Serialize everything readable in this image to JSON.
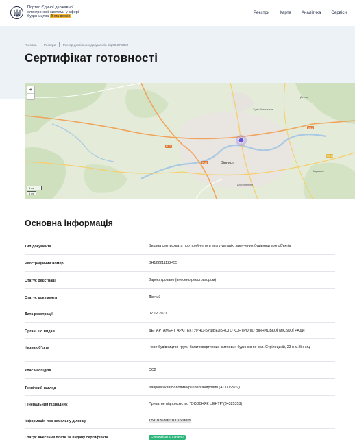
{
  "header": {
    "brand_line1": "Портал Єдиної державної",
    "brand_line2": "електронної системи у сфері",
    "brand_line3": "будівництва",
    "badge": "Бета-версія",
    "nav": [
      "Реєстри",
      "Карта",
      "Аналітика",
      "Сервіси"
    ]
  },
  "breadcrumb": [
    "Головна",
    "Реєстри",
    "Реєстр дозвільних документів від 05.07.2020"
  ],
  "page_title": "Сертифікат готовності",
  "map": {
    "zoom_in": "+",
    "zoom_out": "−",
    "scale_km": "3 км",
    "scale_mi": "1 mi",
    "labels": {
      "city": "Вінниця",
      "district_n": "Хутір Шевченка",
      "village_ne": "Десна",
      "label_agro": "Агрономічне",
      "label_east": "Зарванці",
      "road_a": "М-12",
      "road_b": "М-12",
      "road_c": "Р-33",
      "road_d": "Т-02-12"
    }
  },
  "section_title": "Основна інформація",
  "rows": [
    {
      "key": "Тип документа",
      "value": "Видача сертифіката про прийняття в експлуатацію закінчених будівництвом об'єктів"
    },
    {
      "key": "Реєстраційний номер",
      "value": "ВН122211122455"
    },
    {
      "key": "Статус реєстрації",
      "value": "Зареєстровано (внесено реєстратором)"
    },
    {
      "key": "Статус документа",
      "value": "Діючий"
    },
    {
      "key": "Дата реєстрації",
      "value": "02.12.2021"
    },
    {
      "key": "Орган, що видав",
      "value": "ДЕПАРТАМЕНТ АРХІТЕКТУРНО-БУДІВЕЛЬНОГО КОНТРОЛЮ ВІННИЦЬКОЇ МІСЬКОЇ РАДИ"
    },
    {
      "key": "Назва об'єкта",
      "value": "Нове будівництво групи багатоквартирних житлових будинків по вул. Стрілецькій, 23 в м.Вінниці"
    },
    {
      "key": "Клас наслідків",
      "value": "СС2"
    },
    {
      "key": "Технічний нагляд",
      "value": "Лавровський Володимир Олександрович (АТ 006326 )"
    },
    {
      "key": "Генеральний підрядник",
      "value": "Приватне підприємство \"ОСОБНЯК ЦЕНТР\"(34325353)"
    },
    {
      "key": "Інформація про земельну ділянку",
      "value": "0510136300:01:016:0005"
    },
    {
      "key": "Статус внесення плати за видачу сертифіката",
      "value": "Сертифікат сплачено"
    }
  ]
}
